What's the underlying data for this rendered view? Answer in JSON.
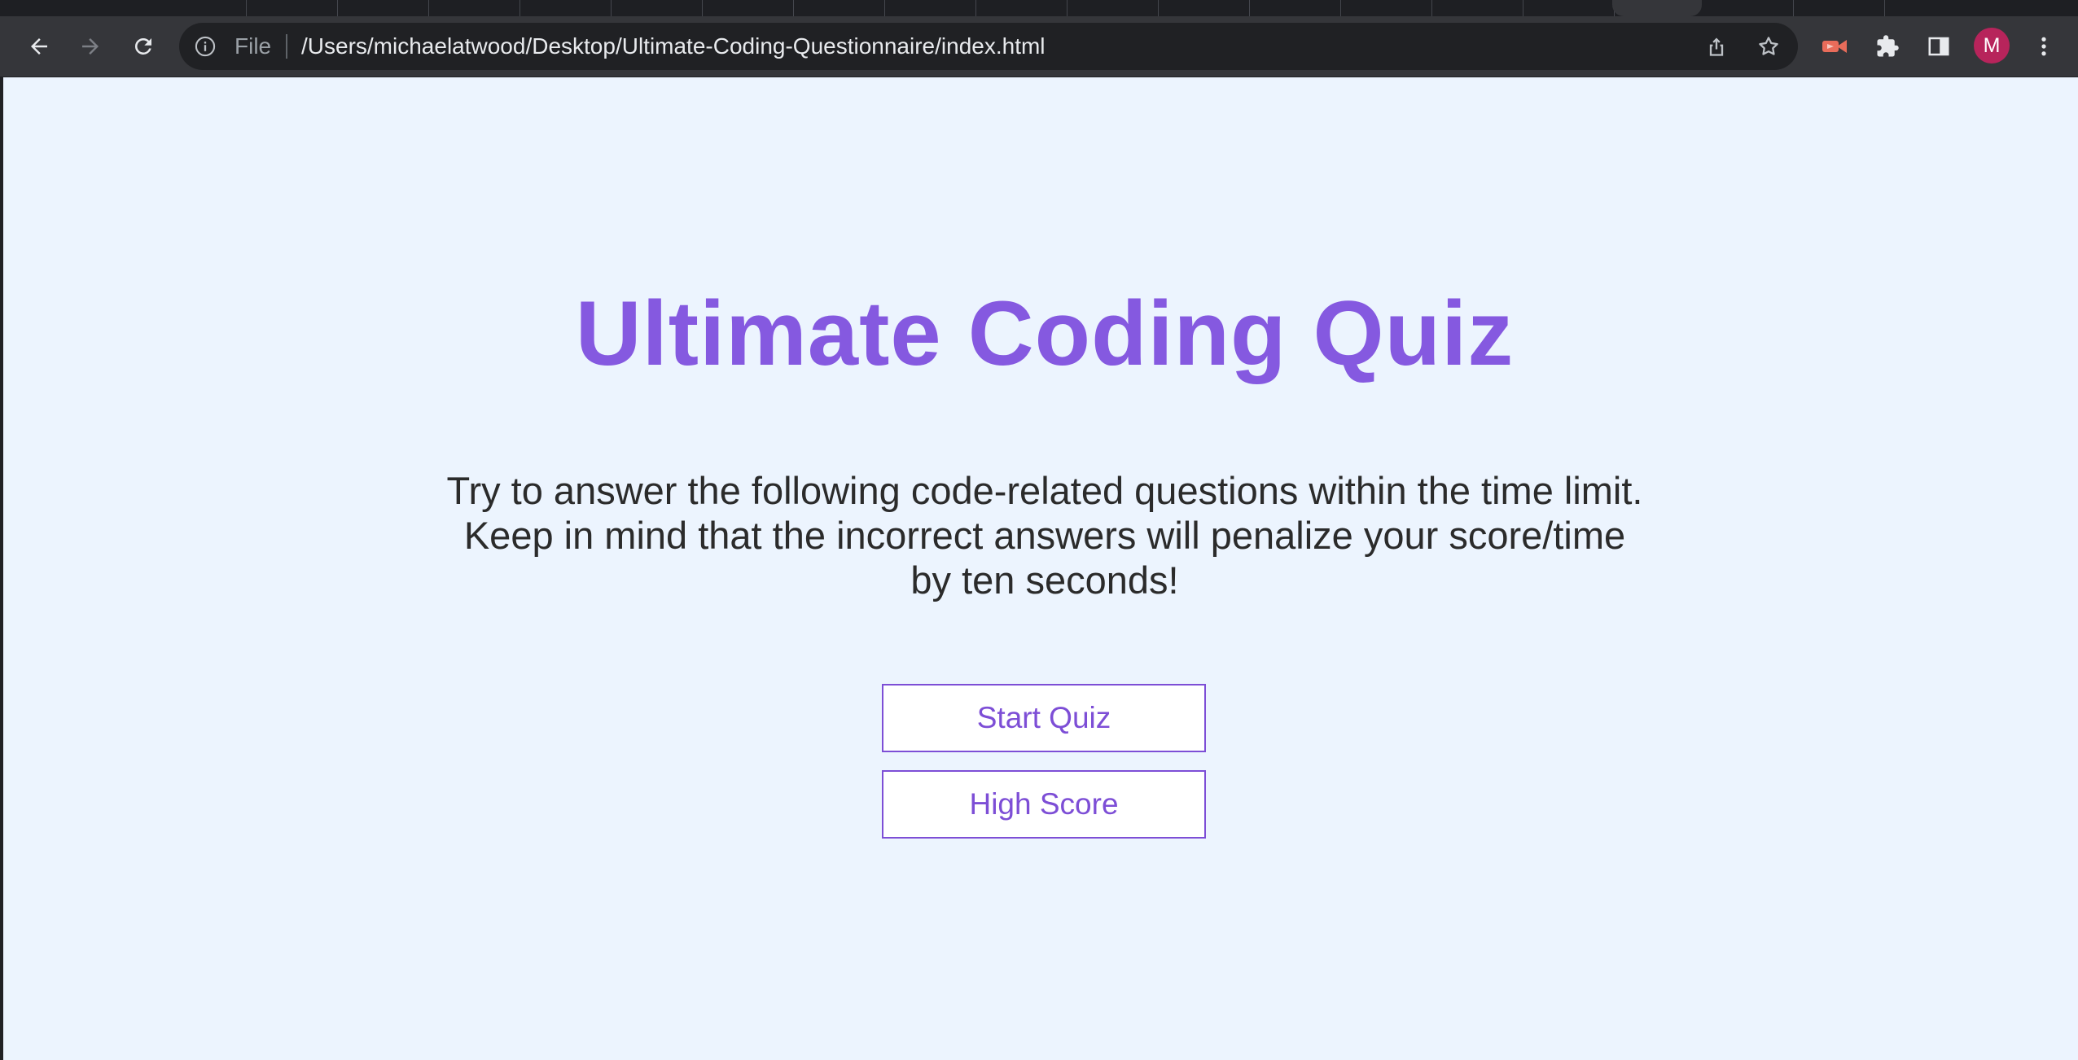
{
  "browser": {
    "address_scheme_label": "File",
    "url": "/Users/michaelatwood/Desktop/Ultimate-Coding-Questionnaire/index.html",
    "profile_initial": "M"
  },
  "page": {
    "title": "Ultimate Coding Quiz",
    "description_lines": [
      "Try to answer the following code-related questions within the time limit.",
      "Keep in mind that the incorrect answers will penalize your score/time",
      "by ten seconds!"
    ],
    "start_button": "Start Quiz",
    "high_score_button": "High Score"
  },
  "colors": {
    "accent": "#8559e0",
    "page_background": "#ecf4fe",
    "chrome_toolbar": "#35363a",
    "avatar": "#b7245b"
  }
}
